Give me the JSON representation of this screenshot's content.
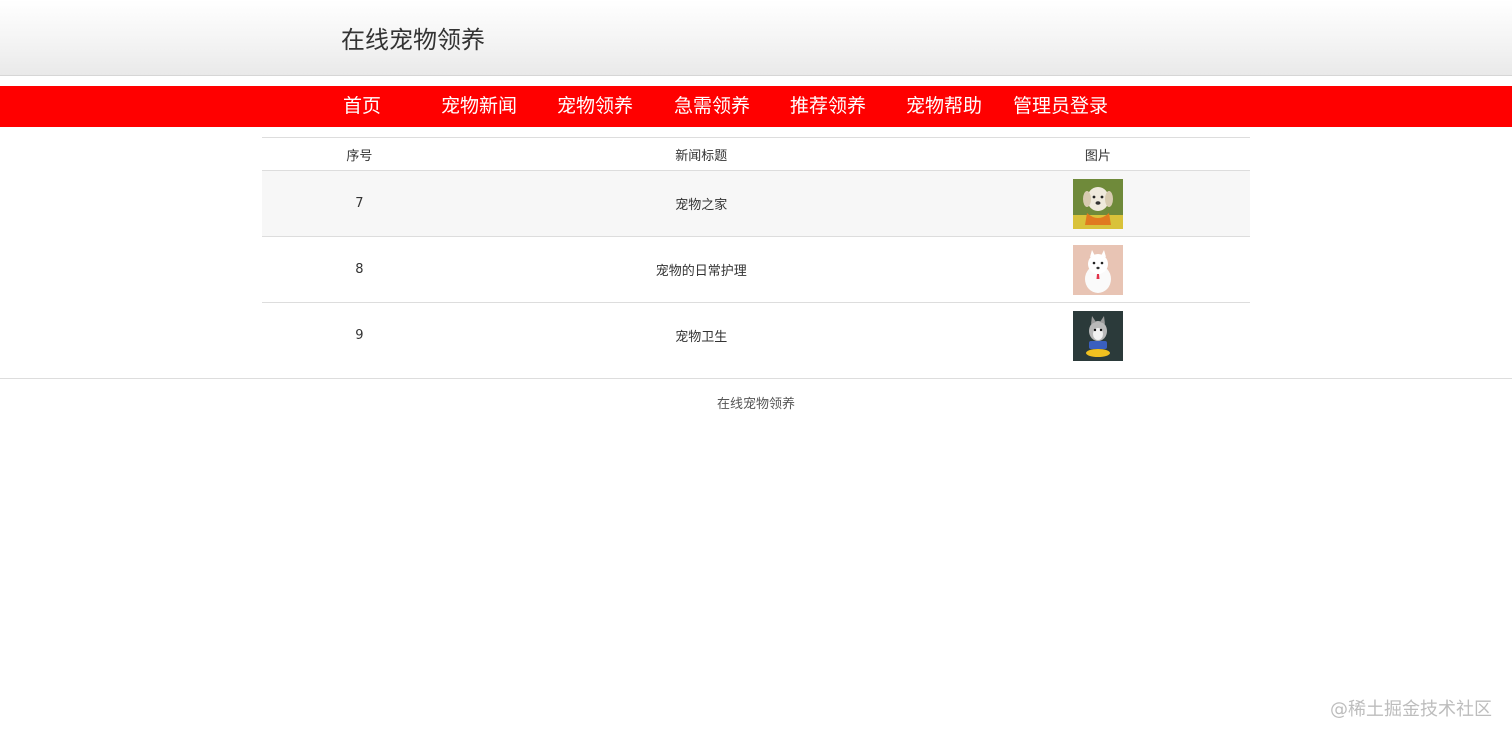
{
  "header": {
    "site_title": "在线宠物领养"
  },
  "nav": {
    "items": [
      {
        "label": "首页"
      },
      {
        "label": "宠物新闻"
      },
      {
        "label": "宠物领养"
      },
      {
        "label": "急需领养"
      },
      {
        "label": "推荐领养"
      },
      {
        "label": "宠物帮助"
      },
      {
        "label": "管理员登录"
      }
    ]
  },
  "table": {
    "headers": {
      "id": "序号",
      "title": "新闻标题",
      "image": "图片"
    },
    "rows": [
      {
        "id": "7",
        "title": "宠物之家",
        "image_icon": "dog-labrador-photo"
      },
      {
        "id": "8",
        "title": "宠物的日常护理",
        "image_icon": "dog-white-photo"
      },
      {
        "id": "9",
        "title": "宠物卫生",
        "image_icon": "dog-husky-photo"
      }
    ]
  },
  "footer": {
    "text": "在线宠物领养"
  },
  "watermark": {
    "text": "@稀土掘金技术社区"
  },
  "colors": {
    "nav_background": "#ff0000",
    "nav_text": "#ffffff",
    "row_stripe": "#f7f7f7",
    "border": "#dddddd"
  }
}
